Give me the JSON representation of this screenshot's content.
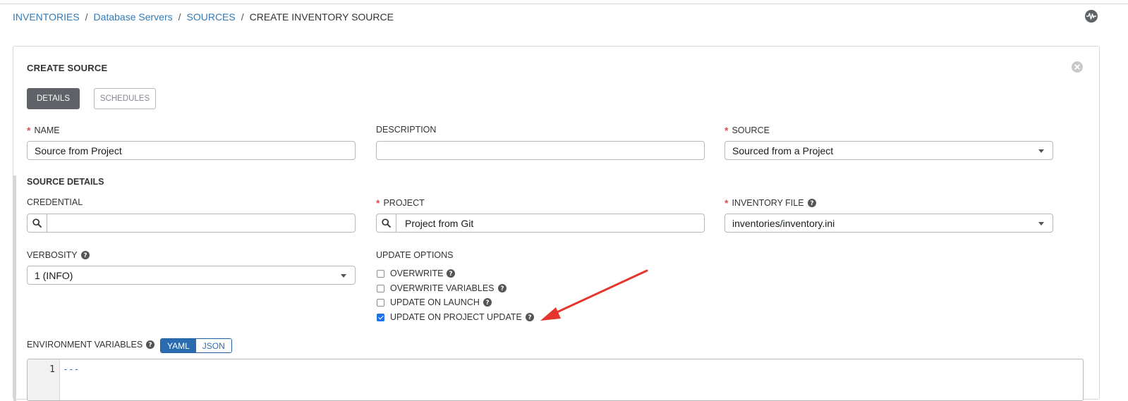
{
  "breadcrumb": {
    "items": [
      "INVENTORIES",
      "Database Servers",
      "SOURCES"
    ],
    "separator": "/",
    "current": "CREATE INVENTORY SOURCE"
  },
  "header": {
    "activity_icon": "activity-stream-icon"
  },
  "panel": {
    "title": "CREATE SOURCE",
    "close_icon": "close-icon",
    "tabs": [
      {
        "label": "DETAILS",
        "active": true
      },
      {
        "label": "SCHEDULES",
        "active": false
      }
    ]
  },
  "form": {
    "name": {
      "label": "NAME",
      "required_mark": "*",
      "value": "Source from Project"
    },
    "description": {
      "label": "DESCRIPTION",
      "value": ""
    },
    "source": {
      "label": "SOURCE",
      "required_mark": "*",
      "value": "Sourced from a Project"
    },
    "source_details_title": "SOURCE DETAILS",
    "credential": {
      "label": "CREDENTIAL",
      "value": ""
    },
    "project": {
      "label": "PROJECT",
      "required_mark": "*",
      "value": "Project from Git"
    },
    "inventory_file": {
      "label": "INVENTORY FILE",
      "required_mark": "*",
      "value": "inventories/inventory.ini"
    },
    "verbosity": {
      "label": "VERBOSITY",
      "value": "1 (INFO)"
    },
    "update_options": {
      "label": "UPDATE OPTIONS",
      "options": [
        {
          "label": "OVERWRITE",
          "checked": false
        },
        {
          "label": "OVERWRITE VARIABLES",
          "checked": false
        },
        {
          "label": "UPDATE ON LAUNCH",
          "checked": false
        },
        {
          "label": "UPDATE ON PROJECT UPDATE",
          "checked": true
        }
      ]
    },
    "environment_variables": {
      "label": "ENVIRONMENT VARIABLES",
      "format_options": [
        "YAML",
        "JSON"
      ],
      "selected_format": "YAML",
      "editor": {
        "line_number": "1",
        "content": "---"
      }
    }
  },
  "colors": {
    "link": "#337ab7",
    "required": "#d9534f",
    "active_tab": "#5f6368",
    "toggle_active": "#2b6cb0",
    "annotation_arrow": "#e8352c",
    "checkbox_checked": "#1a73e8"
  }
}
